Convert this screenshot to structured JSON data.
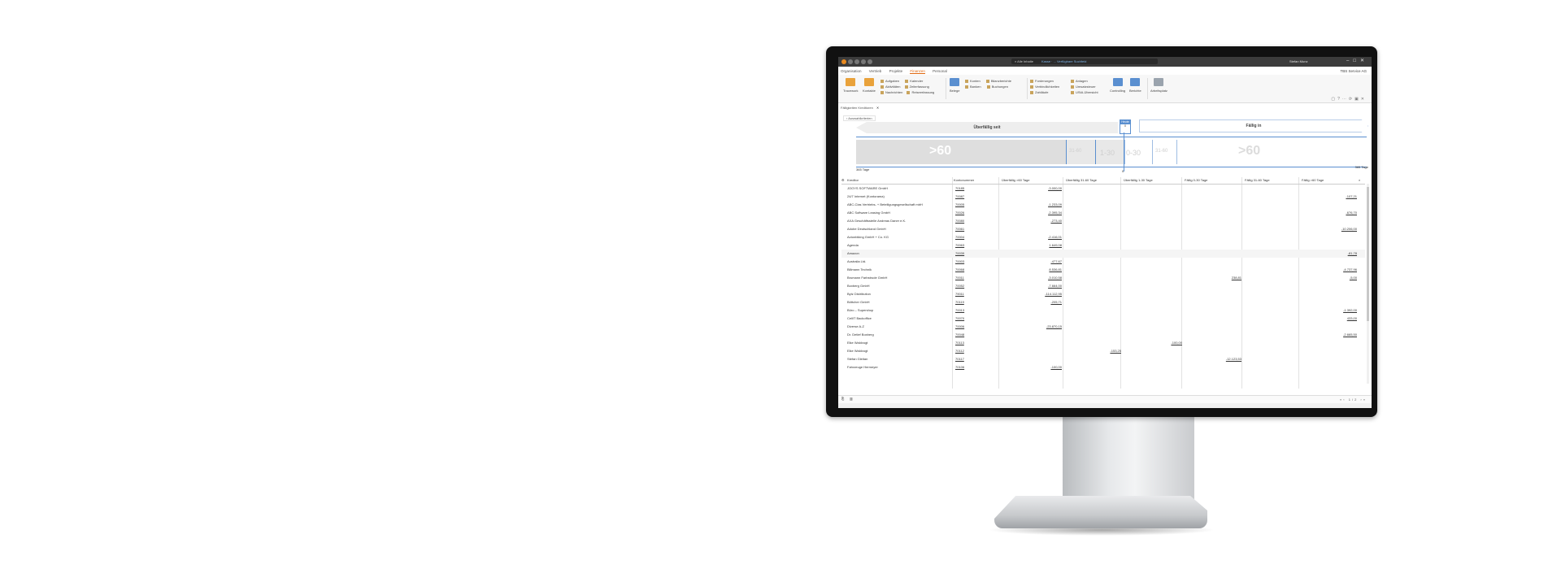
{
  "app": {
    "search_text": "Alle Inhalte",
    "breadcrumb": "Kasse · ... Verfügbare Suchfeld",
    "user": "Stefan Munz",
    "company": "TBS Service AG"
  },
  "menu_tabs": [
    "Organisation",
    "Vertrieb",
    "Projekte",
    "Finanzen",
    "Personal"
  ],
  "active_tab": "Finanzen",
  "ribbon": {
    "tracework": "Tracework",
    "kontakte": "Kontakte",
    "aufgaben": "Aufgaben",
    "kalender": "Kalender",
    "aktivitaeten": "Aktivitäten",
    "zeiterfassung": "Zeiterfassung",
    "nachrichten": "Nachrichten",
    "reiseerfassung": "Reiseerfassung",
    "belege": "Belege",
    "konten": "Konten",
    "bilanzberichte": "Bilanzberichte",
    "banken": "Banken",
    "buchungen": "Buchungen",
    "forderungen": "Forderungen",
    "verbindlichkeiten": "Verbindlichkeiten",
    "zahllaeufe": "Zahlläufe",
    "anlagen": "Anlagen",
    "umsatzsteuer": "Umsatzsteuer",
    "ust_uebersicht": "UStA-Übersicht",
    "controlling": "Controlling",
    "berichte": "Berichte",
    "arbeitsplatz": "Arbeitsplatz"
  },
  "doc_tab": "Fälligkeiten Kreditoren",
  "filter_label": "Auswahlkriterien",
  "aging": {
    "overdue_label": "Überfällig seit",
    "due_label": "Fällig in",
    "today_header": "Heute",
    "today_value": "0",
    "left_big": ">60",
    "right_big": ">60",
    "left_small_a": "31-60",
    "left_small_b": "1-30",
    "left_small_c": "0-30",
    "left_small_d": "31-60",
    "days_left": "365 Tage",
    "days_right": "365 Tage",
    "zero_label": "0"
  },
  "table": {
    "headers": [
      "Kreditor",
      "Kontonummer",
      "Überfällig >60 Tage",
      "Überfällig 31-60 Tage",
      "Überfällig 1-30 Tage",
      "Fällig 0-30 Tage",
      "Fällig 31-60 Tage",
      "Fällig >60 Tage"
    ],
    "rows": [
      {
        "name": "JOOYS SOFTWARE GmbH",
        "acct": "70185",
        "c2": "-3.000,00",
        "c3": "",
        "c4": "",
        "c5": "",
        "c6": "",
        "c7": ""
      },
      {
        "name": "24/7 Internet (Kontorama)",
        "acct": "70087",
        "c2": "",
        "c3": "",
        "c4": "",
        "c5": "",
        "c6": "",
        "c7": "-107,21"
      },
      {
        "name": "ABC-Clas Vertriebs- + Beteiligungsgesellschaft mbH",
        "acct": "70005",
        "c2": "-1.233,09",
        "c3": "",
        "c4": "",
        "c5": "",
        "c6": "",
        "c7": ""
      },
      {
        "name": "ABC Software Leasing GmbH",
        "acct": "70026",
        "c2": "-2.395,34",
        "c3": "",
        "c4": "",
        "c5": "",
        "c6": "",
        "c7": "-676,70"
      },
      {
        "name": "AXA Geschäftsstelle Andreas Daner e.K.",
        "acct": "70080",
        "c2": "-273,40",
        "c3": "",
        "c4": "",
        "c5": "",
        "c6": "",
        "c7": ""
      },
      {
        "name": "Adobe Deutschland GmbH",
        "acct": "70061",
        "c2": "",
        "c3": "",
        "c4": "",
        "c5": "",
        "c6": "",
        "c7": "-10.206,00"
      },
      {
        "name": "Actonbiking GmbH + Co. KG",
        "acct": "70004",
        "c2": "-2.416,01",
        "c3": "",
        "c4": "",
        "c5": "",
        "c6": "",
        "c7": ""
      },
      {
        "name": "Agenda",
        "acct": "70063",
        "c2": "1.649,08",
        "c3": "",
        "c4": "",
        "c5": "",
        "c6": "",
        "c7": ""
      },
      {
        "name": "Amazon",
        "acct": "70039",
        "c2": "",
        "c3": "",
        "c4": "",
        "c5": "",
        "c6": "",
        "c7": "-81,78"
      },
      {
        "name": "Australia Ltd.",
        "acct": "70003",
        "c2": "-477,67",
        "c3": "",
        "c4": "",
        "c5": "",
        "c6": "",
        "c7": ""
      },
      {
        "name": "Billmann Technik",
        "acct": "70068",
        "c2": "8.536,81",
        "c3": "",
        "c4": "",
        "c5": "",
        "c6": "",
        "c7": "-4.737,96"
      },
      {
        "name": "Brumann Farbstrude GmbH",
        "acct": "70011",
        "c2": "-3.010,58",
        "c3": "",
        "c4": "",
        "c5": "238,81",
        "c6": "",
        "c7": "-5,00"
      },
      {
        "name": "Boxberg GmbH",
        "acct": "70052",
        "c2": "-7.664,00",
        "c3": "",
        "c4": "",
        "c5": "",
        "c6": "",
        "c7": ""
      },
      {
        "name": "Bytz Distribution",
        "acct": "79011",
        "c2": "-114.112,95",
        "c3": "",
        "c4": "",
        "c5": "",
        "c6": "",
        "c7": ""
      },
      {
        "name": "Böttcher GmbH",
        "acct": "70119",
        "c2": "-205,71",
        "c3": "",
        "c4": "",
        "c5": "",
        "c6": "",
        "c7": ""
      },
      {
        "name": "Büro – Supershop",
        "acct": "70013",
        "c2": "",
        "c3": "",
        "c4": "",
        "c5": "",
        "c6": "",
        "c7": "-1.392,00"
      },
      {
        "name": "CellIT Backoffice",
        "acct": "70070",
        "c2": "",
        "c3": "",
        "c4": "",
        "c5": "",
        "c6": "",
        "c7": "433,00"
      },
      {
        "name": "Diverse A-Z",
        "acct": "70006",
        "c2": "-23.870,15",
        "c3": "",
        "c4": "",
        "c5": "",
        "c6": "",
        "c7": ""
      },
      {
        "name": "Dr. Detlef Boxberg",
        "acct": "70048",
        "c2": "",
        "c3": "",
        "c4": "",
        "c5": "",
        "c6": "",
        "c7": "-2.665,50"
      },
      {
        "name": "Elke Waldvogt",
        "acct": "70113",
        "c2": "",
        "c3": "",
        "c4": "-100,00",
        "c5": "",
        "c6": "",
        "c7": ""
      },
      {
        "name": "Elke Waldvogt",
        "acct": "70112",
        "c2": "",
        "c3": "-153,25",
        "c4": "",
        "c5": "",
        "c6": "",
        "c7": ""
      },
      {
        "name": "Stefan Gleitan",
        "acct": "70117",
        "c2": "",
        "c3": "",
        "c4": "",
        "c5": "-12.123,53",
        "c6": "",
        "c7": ""
      },
      {
        "name": "Fahrzeuge Hermeyer",
        "acct": "70106",
        "c2": "-100,00",
        "c3": "",
        "c4": "",
        "c5": "",
        "c6": "",
        "c7": ""
      }
    ]
  },
  "pager": {
    "page": "1",
    "total": "2"
  },
  "colors": {
    "accent": "#e06a12",
    "blue": "#5a8fd0",
    "bezel": "#111111"
  }
}
